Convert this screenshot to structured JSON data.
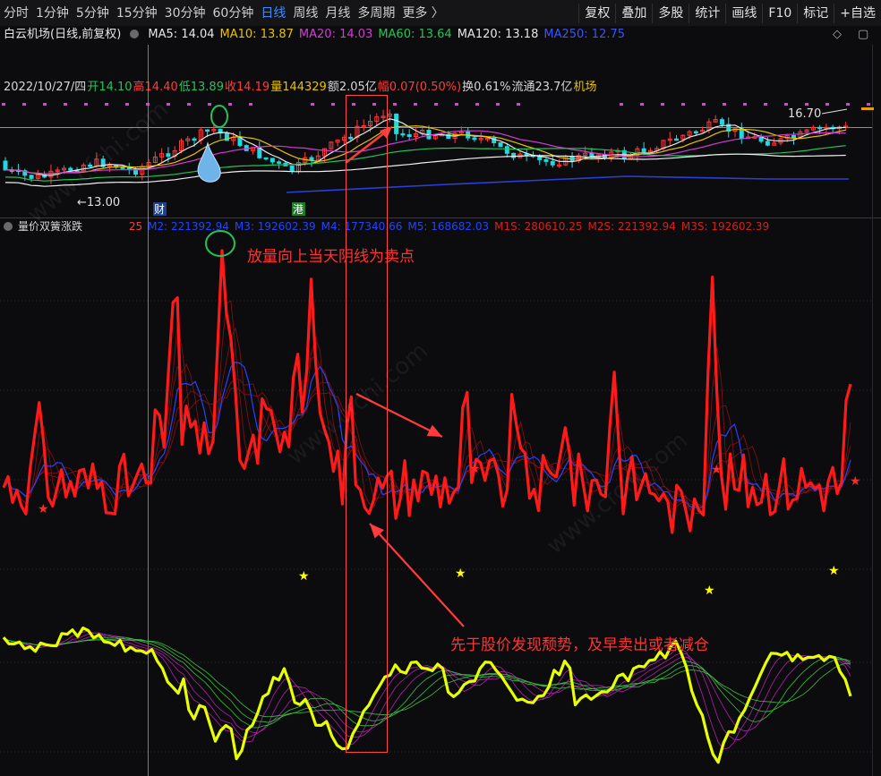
{
  "toolbar": {
    "periods": [
      "分时",
      "1分钟",
      "5分钟",
      "15分钟",
      "30分钟",
      "60分钟",
      "日线",
      "周线",
      "月线",
      "多周期",
      "更多 〉"
    ],
    "active_period": "日线",
    "tools": [
      "复权",
      "叠加",
      "多股",
      "统计",
      "画线",
      "F10",
      "标记",
      "+自选"
    ]
  },
  "stock": {
    "name": "白云机场(日线,前复权)",
    "ma": [
      {
        "label": "MA5: 14.04",
        "color": "#e6e6e6"
      },
      {
        "label": "MA10: 13.87",
        "color": "#e8c000"
      },
      {
        "label": "MA20: 14.03",
        "color": "#d23cd2"
      },
      {
        "label": "MA60: 13.64",
        "color": "#22c35a"
      },
      {
        "label": "MA120: 13.18",
        "color": "#e6e6e6"
      },
      {
        "label": "MA250: 12.75",
        "color": "#3a54ff"
      }
    ],
    "info": [
      {
        "t": "2022/10/27/四",
        "c": "#d6d6d6"
      },
      {
        "t": "开14.10",
        "c": "#22c35a"
      },
      {
        "t": "高14.40",
        "c": "#ff3b3b"
      },
      {
        "t": "低13.89",
        "c": "#22c35a"
      },
      {
        "t": "收14.19",
        "c": "#ff3b3b"
      },
      {
        "t": "量144329",
        "c": "#e8c000"
      },
      {
        "t": "额2.05亿",
        "c": "#d6d6d6"
      },
      {
        "t": "幅0.07(0.50%)",
        "c": "#ff3b3b"
      },
      {
        "t": "换0.61%",
        "c": "#d6d6d6"
      },
      {
        "t": "流通23.7亿",
        "c": "#d6d6d6"
      },
      {
        "t": "机场",
        "c": "#e8c000"
      }
    ],
    "price_high_label": "16.70",
    "price_low_label": "←13.00",
    "markers": [
      "财",
      "港"
    ]
  },
  "indicator": {
    "name": "量价双簧涨跌",
    "values": [
      {
        "t": "25",
        "c": "#ff3b3b"
      },
      {
        "t": "M2: 221392.94",
        "c": "#2244ff"
      },
      {
        "t": "M3: 192602.39",
        "c": "#2244ff"
      },
      {
        "t": "M4: 177340.66",
        "c": "#2244ff"
      },
      {
        "t": "M5: 168682.03",
        "c": "#2244ff"
      },
      {
        "t": "M1S: 280610.25",
        "c": "#d42020"
      },
      {
        "t": "M2S: 221392.94",
        "c": "#d42020"
      },
      {
        "t": "M3S: 192602.39",
        "c": "#d42020"
      }
    ]
  },
  "annotations": {
    "sell_point": "放量向上当天阴线为卖点",
    "early_warning": "先于股价发现颓势，及早卖出或者减仓"
  },
  "watermark": "www.cfchi.com",
  "colors": {
    "up": "#ff3b3b",
    "down": "#22d8e0",
    "accent": "#3c8cff",
    "osc": "#e8ff00"
  }
}
